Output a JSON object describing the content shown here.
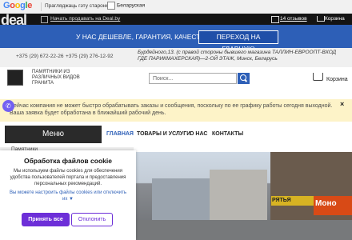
{
  "translate_bar": {
    "logo": "Google",
    "message": "Прагляджаць гэту старонку",
    "language": "Беларуская"
  },
  "topbar": {
    "logo": "deal",
    "mobile_link": "Начать продавать на Deal.by",
    "reviews": "14 отзывов",
    "cart": "Корзина"
  },
  "promo": {
    "text": "У НАС ДЕШЕВЛЕ, ГАРАНТИЯ, КАЧЕСТВО",
    "button": "ПЕРЕХОД НА ГЛАВНУЮ"
  },
  "contacts": {
    "phone1": "+375 (29) 672-22-26",
    "phone2": "+375 (29) 276-12-92",
    "address": "Бурдейного,13. (с правой стороны бывшего магазина ТАЛЛИН-ЕВРООПТ-ВХОД ГДЕ ПАРИКМАХЕРСКАЯ)—2-ОЙ ЭТАЖ, Минск, Беларусь"
  },
  "company": {
    "tagline": "ПАМЯТНИКИ ИЗ РАЗЛИЧНЫХ ВИДОВ ГРАНИТА"
  },
  "search": {
    "placeholder": "Поиск..."
  },
  "cart_label": "Корзина",
  "notice": {
    "text": "Сейчас компания не может быстро обрабатывать заказы и сообщения, поскольку по ее графику работы сегодня выходной. Ваша заявка будет обработана в ближайший рабочий день.",
    "close": "×"
  },
  "menu": {
    "button": "Меню",
    "items": [
      "ГЛАВНАЯ",
      "ТОВАРЫ И УСЛУГИ",
      "О НАС",
      "КОНТАКТЫ"
    ]
  },
  "content": {
    "left_label": "Памятники",
    "shop_sign_1": "РЯТЬЯ",
    "shop_sign_2": "Моно"
  },
  "cookie": {
    "title": "Обработка файлов cookie",
    "text": "Мы используем файлы cookies для обеспечения удобства пользователей портала и предоставления персональных рекомендаций.",
    "link": "Вы можете настроить файлы cookies или отключить их ▼",
    "accept": "Принять все",
    "reject": "Отклонить"
  },
  "colors": {
    "promo_blue": "#2d5fb7",
    "accept_purple": "#6d2fd8",
    "notice_yellow": "#fdf3c8"
  }
}
